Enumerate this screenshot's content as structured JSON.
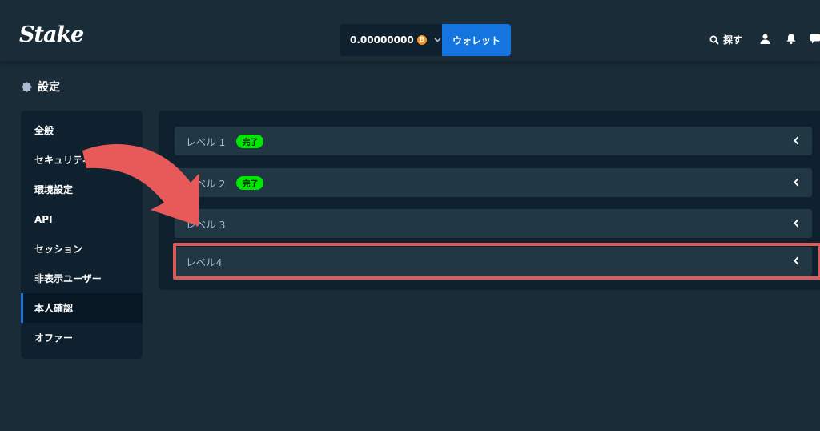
{
  "header": {
    "logo": "Stake",
    "balance": "0.00000000",
    "coin_symbol": "₿",
    "wallet_label": "ウォレット",
    "search_label": "探す"
  },
  "page": {
    "title": "設定"
  },
  "sidebar": {
    "items": [
      {
        "label": "全般"
      },
      {
        "label": "セキュリティ"
      },
      {
        "label": "環境設定"
      },
      {
        "label": "API"
      },
      {
        "label": "セッション"
      },
      {
        "label": "非表示ユーザー"
      },
      {
        "label": "本人確認"
      },
      {
        "label": "オファー"
      }
    ],
    "active": "本人確認"
  },
  "levels": [
    {
      "label": "レベル 1",
      "badge": "完了"
    },
    {
      "label": "レベル 2",
      "badge": "完了"
    },
    {
      "label": "レベル 3"
    },
    {
      "label": "レベル4"
    }
  ],
  "colors": {
    "background": "#1a2c38",
    "panel": "#0f212e",
    "row": "#213743",
    "accent_blue": "#1475e1",
    "badge_green": "#00e701",
    "annotation_red": "#e05a5a"
  }
}
